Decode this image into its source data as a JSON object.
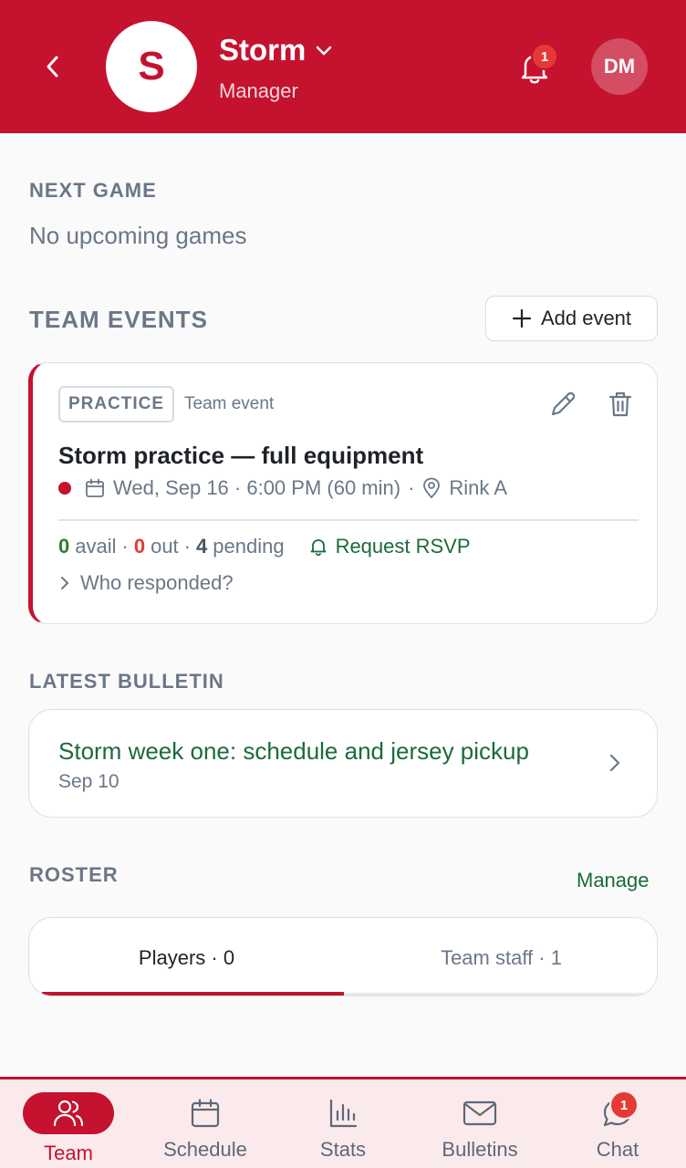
{
  "header": {
    "team_initial": "S",
    "team_name": "Storm",
    "role": "Manager",
    "notification_count": "1",
    "user_initials": "DM"
  },
  "next_game": {
    "label": "NEXT GAME",
    "empty_text": "No upcoming games"
  },
  "team_events": {
    "label": "TEAM EVENTS",
    "add_button": "Add event",
    "event": {
      "tag": "PRACTICE",
      "tag_sub": "Team event",
      "title": "Storm practice — full equipment",
      "date": "Wed, Sep 16 · 6:00 PM (60 min)",
      "separator": "·",
      "location": "Rink A",
      "avail_count": "0",
      "avail_label": "avail",
      "out_count": "0",
      "out_label": "out",
      "pending_count": "4",
      "pending_label": "pending",
      "dot": "·",
      "request_rsvp": "Request RSVP",
      "who_responded": "Who responded?"
    }
  },
  "bulletin": {
    "label": "LATEST BULLETIN",
    "title": "Storm week one: schedule and jersey pickup",
    "date": "Sep 10"
  },
  "roster": {
    "label": "ROSTER",
    "manage": "Manage",
    "tabs": [
      {
        "label": "Players · 0"
      },
      {
        "label": "Team staff · 1"
      }
    ]
  },
  "bottom_nav": {
    "items": [
      {
        "label": "Team",
        "icon": "team-icon"
      },
      {
        "label": "Schedule",
        "icon": "calendar-icon"
      },
      {
        "label": "Stats",
        "icon": "stats-icon"
      },
      {
        "label": "Bulletins",
        "icon": "mail-icon"
      },
      {
        "label": "Chat",
        "icon": "chat-icon"
      }
    ],
    "chat_badge": "1"
  },
  "colors": {
    "brand": "#c4122f",
    "link_green": "#1b6b3a",
    "muted": "#6b7787"
  }
}
